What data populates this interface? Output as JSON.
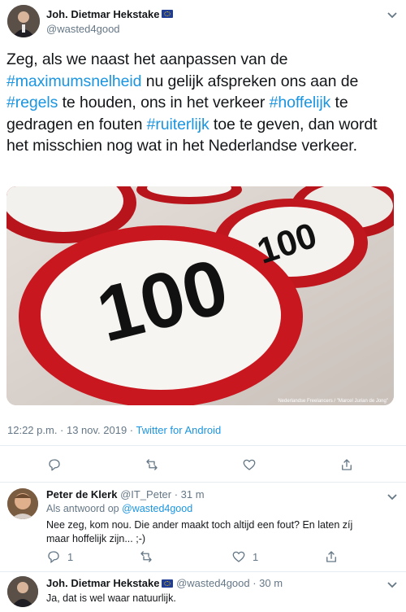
{
  "main_tweet": {
    "author": "Joh. Dietmar Hekstake",
    "handle": "@wasted4good",
    "text_parts": [
      "Zeg, als we naast het aanpassen van de ",
      "#maximumsnelheid",
      " nu gelijk afspreken ons aan de ",
      "#regels",
      " te houden, ons in het verkeer ",
      "#hoffelijk",
      " te gedragen en fouten ",
      "#ruiterlijk",
      " toe te geven, dan wordt het misschien nog wat in het Nederlandse verkeer."
    ],
    "image_credit": "Nederlandse Freelancers / \"Marcel Jurian de Jong\"",
    "sign_text": "100",
    "timestamp": "12:22 p.m. · 13 nov. 2019 · ",
    "source": "Twitter for Android"
  },
  "actions": {
    "reply": "chat-bubble-icon",
    "retweet": "retweet-icon",
    "like": "heart-icon",
    "share": "share-icon"
  },
  "reply1": {
    "author": "Peter de Klerk",
    "handle": "@IT_Peter",
    "time": " · 31 m",
    "reply_to_label": "Als antwoord op ",
    "reply_to_handle": "@wasted4good",
    "text": "Nee zeg, kom nou. Die ander maakt toch altijd een fout? En laten zíj maar hoffelijk zijn...  ;-)",
    "reply_count": "1",
    "like_count": "1"
  },
  "reply2": {
    "author": "Joh. Dietmar Hekstake",
    "handle": "@wasted4good",
    "time": " · 30 m",
    "text": "Ja, dat is wel waar natuurlijk."
  },
  "colors": {
    "accent": "#1b95e0",
    "muted": "#657786",
    "divider": "#e6ecf0"
  }
}
